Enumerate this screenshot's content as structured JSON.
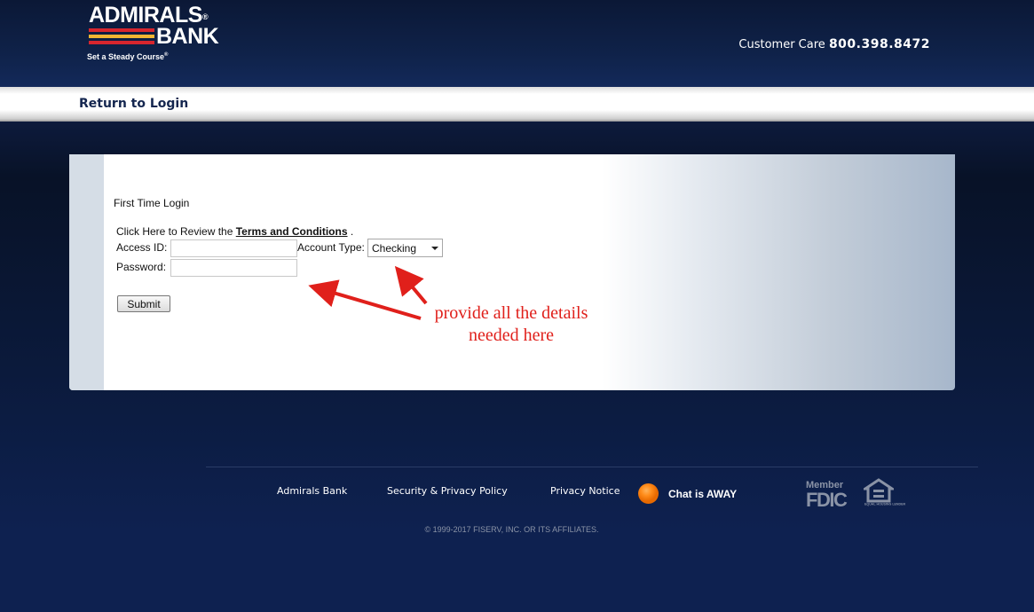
{
  "header": {
    "logo_line1": "ADMIRALS",
    "logo_line2": "BANK",
    "logo_reg": "®",
    "tagline": "Set a Steady Course",
    "tagline_reg": "®",
    "customer_care_label": "Customer Care",
    "customer_care_phone": "800.398.8472"
  },
  "nav": {
    "return_label": "Return to Login"
  },
  "form": {
    "title": "First Time Login",
    "terms_prefix": "Click Here to Review the",
    "terms_link": "Terms and Conditions",
    "terms_suffix": ".",
    "access_id_label": "Access ID:",
    "access_id_value": "",
    "account_type_label": "Account Type:",
    "account_type_value": "Checking",
    "password_label": "Password:",
    "password_value": "",
    "submit_label": "Submit"
  },
  "annotation": {
    "line1": "provide all the details",
    "line2": "needed here",
    "color": "#e0201b"
  },
  "footer": {
    "links": [
      "Admirals Bank",
      "Security & Privacy Policy",
      "Privacy Notice"
    ],
    "chat_status": "Chat is AWAY",
    "fdic_member": "Member",
    "fdic": "FDIC",
    "equal_housing": "EQUAL HOUSING LENDER",
    "copyright": "© 1999-2017 FISERV, INC. OR ITS AFFILIATES."
  },
  "colors": {
    "navy_background": "#0e2150",
    "logo_red": "#d7262e",
    "logo_yellow": "#f2b632",
    "chat_orange": "#ff8c1a"
  }
}
